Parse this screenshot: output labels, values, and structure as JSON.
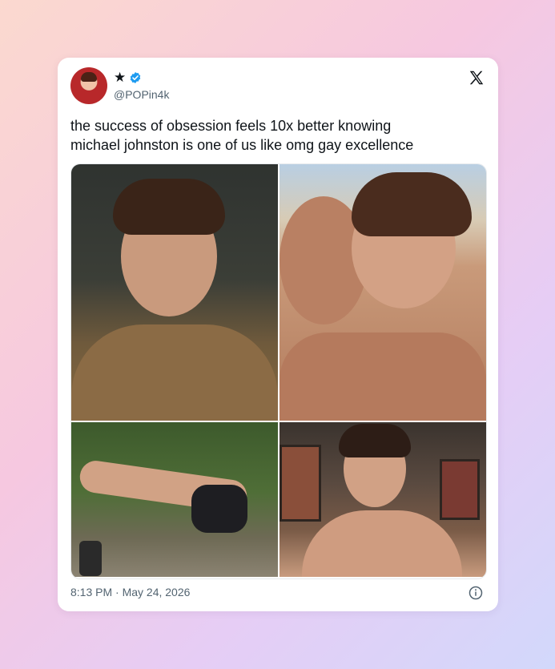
{
  "tweet": {
    "display_name": "★",
    "handle": "@POPin4k",
    "text_line1": "the success of obsession feels 10x better knowing",
    "text_line2": "michael johnston is one of us like omg gay excellence",
    "timestamp": "8:13 PM · May 24, 2026"
  },
  "icons": {
    "verified": "verified-badge-icon",
    "platform": "x-logo-icon",
    "info": "info-icon"
  },
  "colors": {
    "verified_blue": "#1d9bf0",
    "text_primary": "#0f1419",
    "text_secondary": "#536471"
  }
}
